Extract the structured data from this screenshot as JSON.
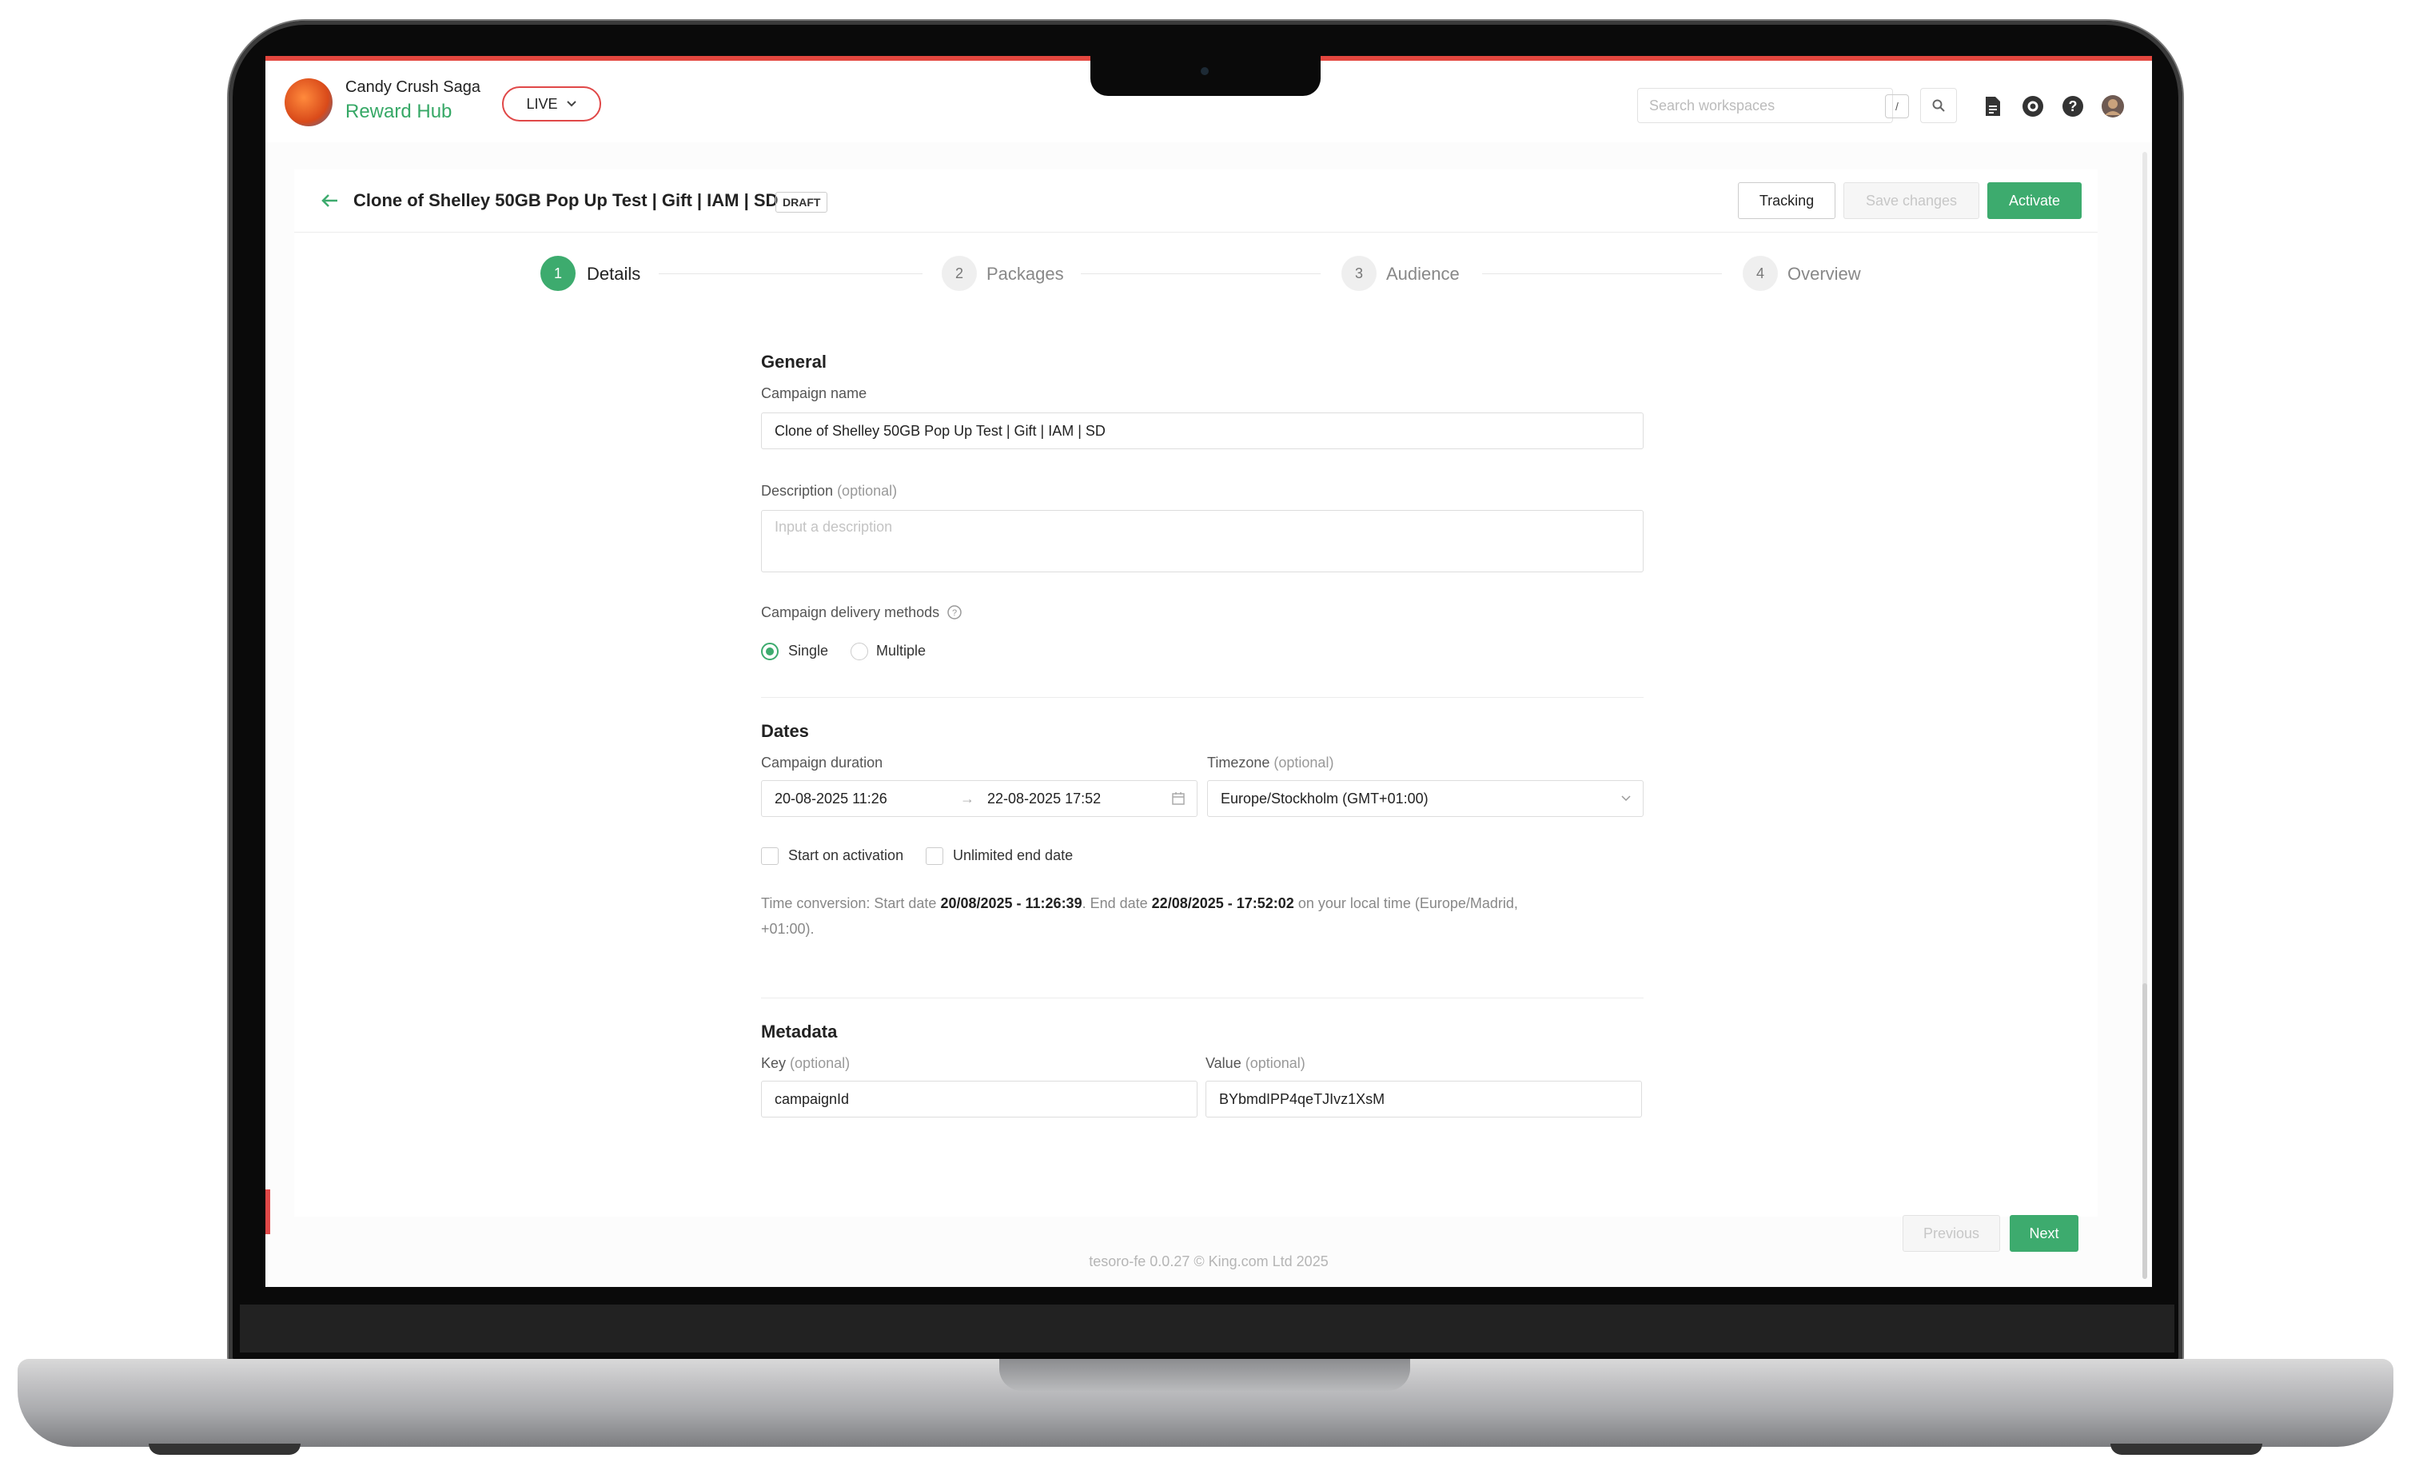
{
  "header": {
    "game": "Candy Crush Saga",
    "app": "Reward Hub",
    "environment": "LIVE",
    "search_placeholder": "Search workspaces",
    "search_shortcut": "/"
  },
  "page": {
    "title": "Clone of Shelley 50GB Pop Up Test | Gift | IAM | SD",
    "status_badge": "DRAFT",
    "buttons": {
      "tracking": "Tracking",
      "save": "Save changes",
      "activate": "Activate"
    }
  },
  "steps": [
    {
      "number": "1",
      "label": "Details",
      "active": true
    },
    {
      "number": "2",
      "label": "Packages",
      "active": false
    },
    {
      "number": "3",
      "label": "Audience",
      "active": false
    },
    {
      "number": "4",
      "label": "Overview",
      "active": false
    }
  ],
  "general": {
    "title": "General",
    "campaign_name_label": "Campaign name",
    "campaign_name_value": "Clone of Shelley 50GB Pop Up Test | Gift | IAM | SD",
    "description_label": "Description",
    "description_optional": "(optional)",
    "description_placeholder": "Input a description",
    "delivery_label": "Campaign delivery methods",
    "delivery_options": [
      "Single",
      "Multiple"
    ],
    "delivery_selected": "Single"
  },
  "dates": {
    "title": "Dates",
    "duration_label": "Campaign duration",
    "start": "20-08-2025 11:26",
    "separator": "→",
    "end": "22-08-2025 17:52",
    "timezone_label": "Timezone",
    "timezone_optional": "(optional)",
    "timezone_value": "Europe/Stockholm (GMT+01:00)",
    "start_on_activation": "Start on activation",
    "unlimited_end": "Unlimited end date",
    "conversion_prefix": "Time conversion: Start date ",
    "conversion_start": "20/08/2025 - 11:26:39",
    "conversion_mid": ". End date ",
    "conversion_end": "22/08/2025 - 17:52:02",
    "conversion_suffix": " on your local time (Europe/Madrid,",
    "conversion_line2": "+01:00)."
  },
  "metadata": {
    "title": "Metadata",
    "key_label": "Key",
    "key_optional": "(optional)",
    "key_value": "campaignId",
    "value_label": "Value",
    "value_optional": "(optional)",
    "value_value": "BYbmdIPP4qeTJIvz1XsM"
  },
  "nav": {
    "previous": "Previous",
    "next": "Next"
  },
  "footer": "tesoro-fe 0.0.27 © King.com Ltd 2025",
  "colors": {
    "primary": "#3dab6e",
    "live": "#e04848",
    "topline": "#e4473f"
  }
}
